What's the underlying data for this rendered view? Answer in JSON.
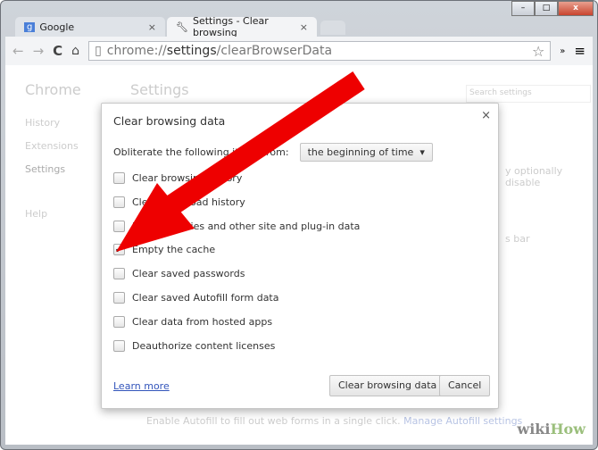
{
  "window": {
    "minimize": "–",
    "maximize": "□",
    "close": "x"
  },
  "tabs": [
    {
      "label": "Google",
      "close": "×"
    },
    {
      "label": "Settings - Clear browsing",
      "close": "×"
    }
  ],
  "toolbar": {
    "url_prefix": "chrome://",
    "url_host": "settings",
    "url_path": "/clearBrowserData"
  },
  "background": {
    "brand": "Chrome",
    "title": "Settings",
    "search_placeholder": "Search settings",
    "nav": [
      "History",
      "Extensions",
      "Settings",
      "Help"
    ],
    "frag1": "y optionally disable",
    "frag2": "s bar",
    "autofill": "Enable Autofill to fill out web forms in a single click.",
    "autofill_link": "Manage Autofill settings"
  },
  "dialog": {
    "title": "Clear browsing data",
    "close": "×",
    "obliterate_label": "Obliterate the following items from:",
    "period": "the beginning of time",
    "items": [
      {
        "label": "Clear browsing history",
        "checked": false
      },
      {
        "label": "Clear download history",
        "checked": false
      },
      {
        "label": "Delete cookies and other site and plug-in data",
        "checked": false
      },
      {
        "label": "Empty the cache",
        "checked": true
      },
      {
        "label": "Clear saved passwords",
        "checked": false
      },
      {
        "label": "Clear saved Autofill form data",
        "checked": false
      },
      {
        "label": "Clear data from hosted apps",
        "checked": false
      },
      {
        "label": "Deauthorize content licenses",
        "checked": false
      }
    ],
    "learn_more": "Learn more",
    "clear_button": "Clear browsing data",
    "cancel_button": "Cancel"
  },
  "annotation_color": "#ee0000",
  "watermark": {
    "a": "wiki",
    "b": "How"
  }
}
